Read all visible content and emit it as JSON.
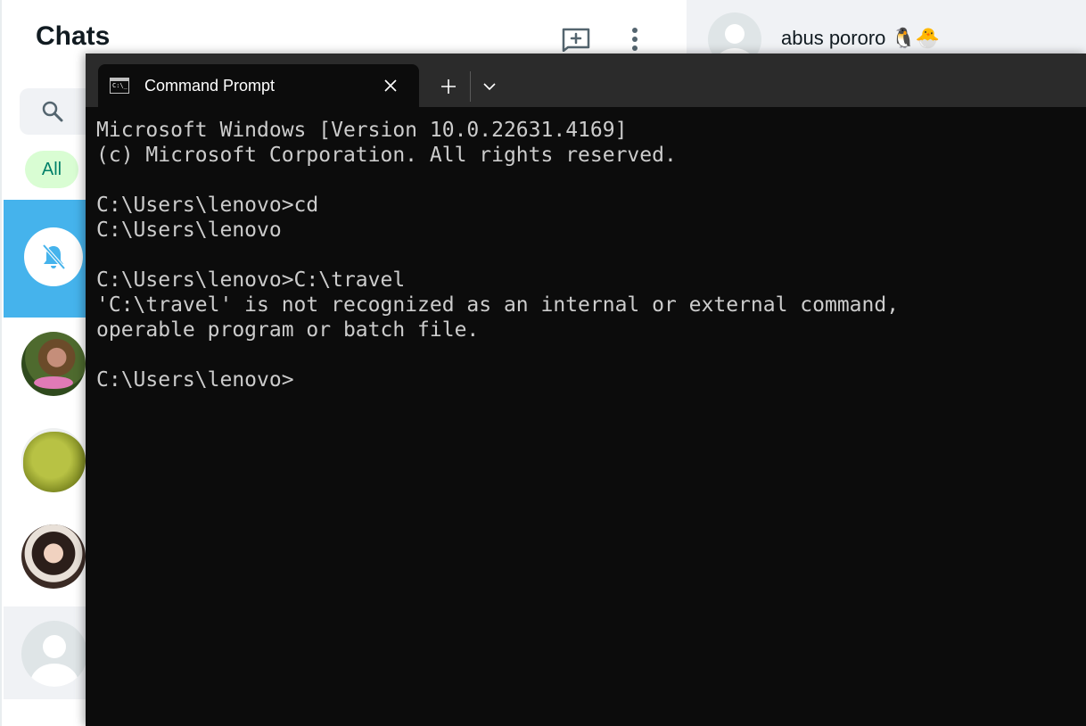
{
  "chat_app": {
    "title": "Chats",
    "new_chat_icon": "new-chat-icon",
    "menu_icon": "kebab-menu-icon",
    "search_icon": "search-icon",
    "filter_all": "All",
    "contact_name": "abus pororo 🐧🐣",
    "accent_color": "#45b3ec"
  },
  "terminal": {
    "tab_title": "Command Prompt",
    "tab_icon": "cmd-icon",
    "close_icon": "close-icon",
    "new_tab_icon": "plus-icon",
    "dropdown_icon": "chevron-down-icon",
    "lines": [
      "Microsoft Windows [Version 10.0.22631.4169]",
      "(c) Microsoft Corporation. All rights reserved.",
      "",
      "C:\\Users\\lenovo>cd",
      "C:\\Users\\lenovo",
      "",
      "C:\\Users\\lenovo>C:\\travel",
      "'C:\\travel' is not recognized as an internal or external command,",
      "operable program or batch file.",
      "",
      "C:\\Users\\lenovo>"
    ]
  }
}
